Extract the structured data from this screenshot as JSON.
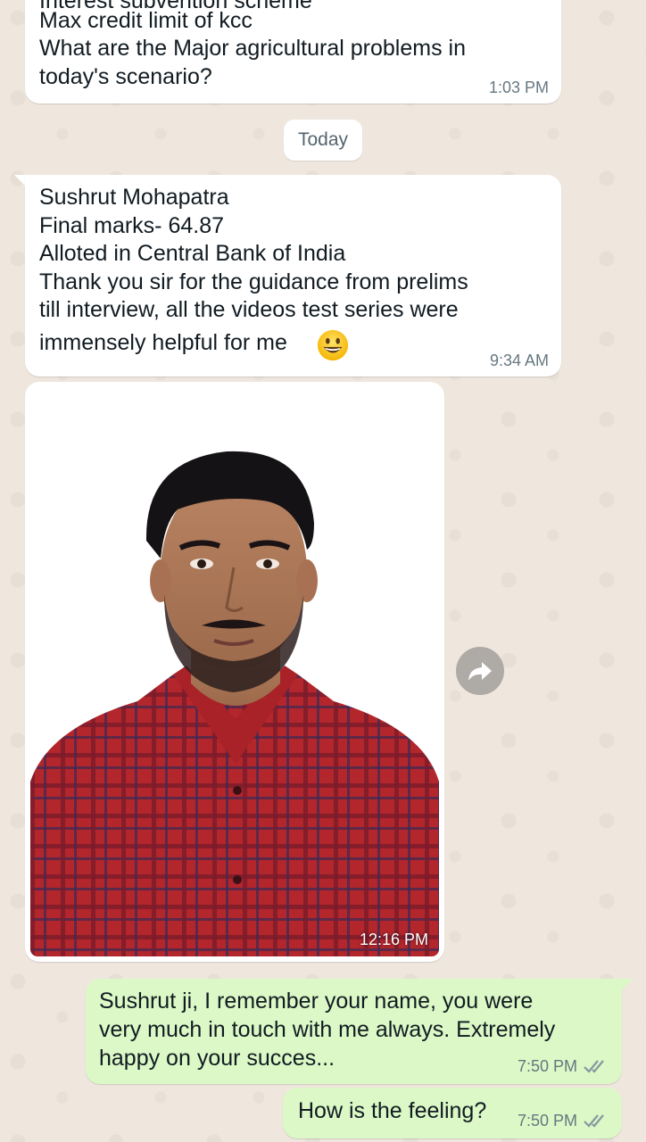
{
  "messages": {
    "m1": {
      "partial_line": "Interest subvention scheme",
      "lines": [
        "Max credit limit of kcc",
        "What are the Major agricultural problems in",
        "today's scenario?"
      ],
      "time": "1:03 PM"
    },
    "date_divider": "Today",
    "m2": {
      "lines": [
        "Sushrut Mohapatra",
        "Final marks- 64.87",
        "Alloted in Central Bank of India",
        "Thank you sir for the guidance from prelims",
        "till interview, all the videos test series were",
        "immensely helpful for me"
      ],
      "emoji": "grinning-face",
      "time": "9:34 AM"
    },
    "m3": {
      "image": "portrait-photo",
      "time": "12:16 PM"
    },
    "m4": {
      "lines": [
        "Sushrut ji, I remember your name, you were",
        "very much in touch with me always. Extremely",
        "happy on your succes..."
      ],
      "time": "7:50 PM",
      "status": "read-double-check"
    },
    "m5": {
      "text": "How is the feeling?",
      "time": "7:50 PM",
      "status": "read-double-check"
    }
  },
  "icons": {
    "forward": "forward-icon",
    "read_receipt": "double-check-icon"
  },
  "colors": {
    "incoming_bubble": "#ffffff",
    "outgoing_bubble": "#dcf8c6",
    "wallpaper": "#efe7de",
    "timestamp": "#667781",
    "read_check": "#8696a0"
  }
}
